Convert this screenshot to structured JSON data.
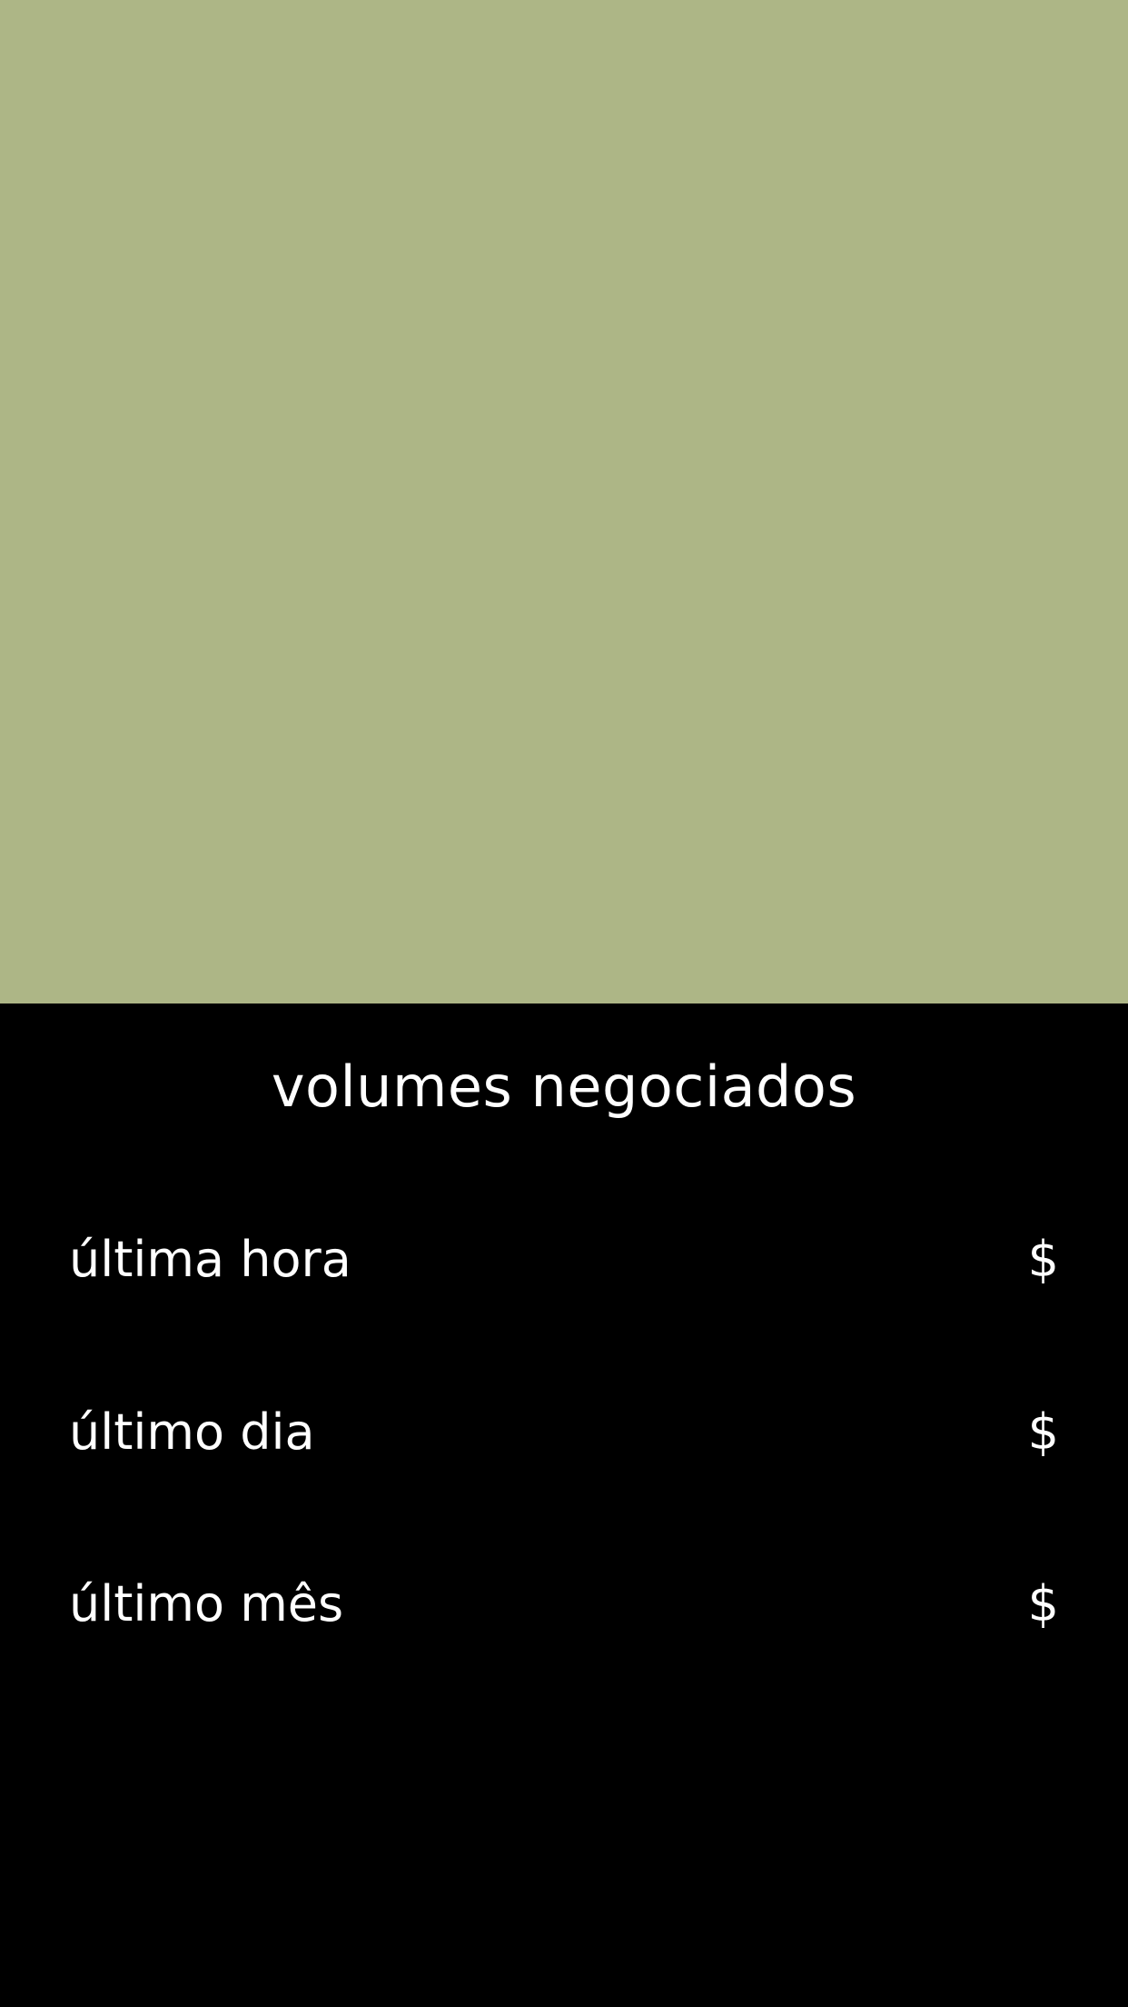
{
  "colors": {
    "top_panel_background": "#adb686",
    "bottom_panel_background": "#000000",
    "text": "#ffffff"
  },
  "volumes": {
    "title": "volumes negociados",
    "rows": [
      {
        "label": "última hora",
        "value": "$"
      },
      {
        "label": "último dia",
        "value": "$"
      },
      {
        "label": "último mês",
        "value": "$"
      }
    ]
  }
}
